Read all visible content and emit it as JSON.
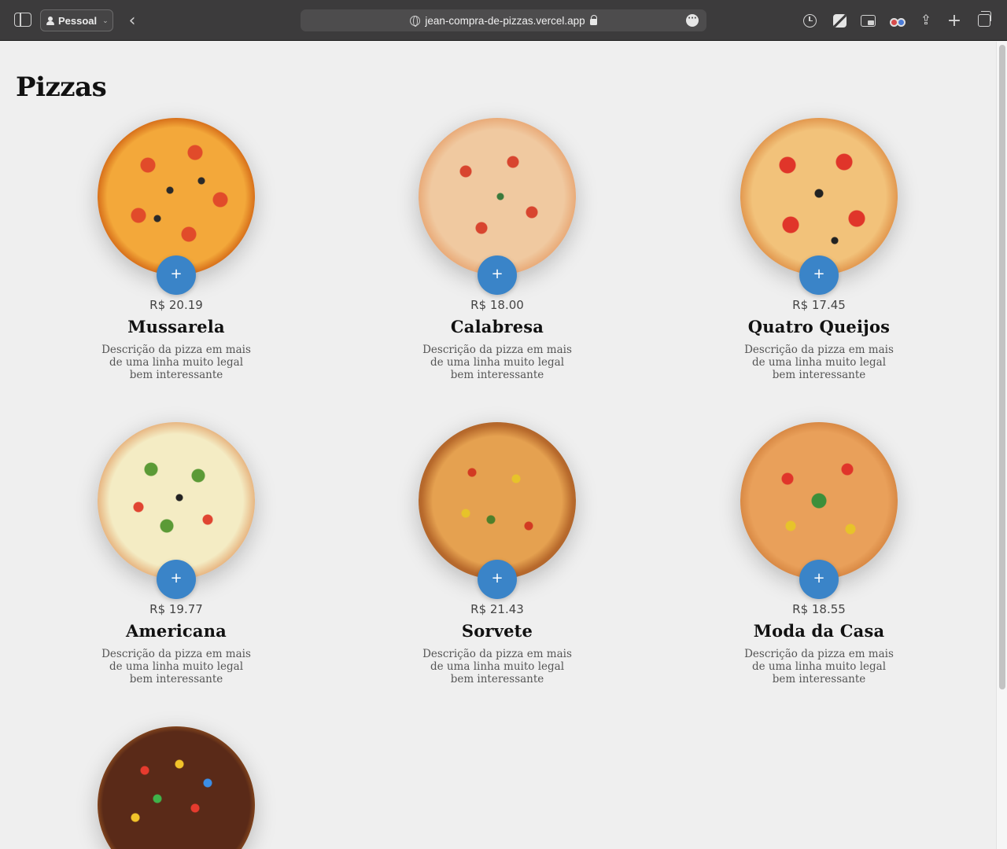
{
  "browser": {
    "profile_label": "Pessoal",
    "url": "jean-compra-de-pizzas.vercel.app",
    "icons": [
      "sidebar-icon",
      "person-icon",
      "chevron-down-icon",
      "back-icon",
      "globe-icon",
      "lock-icon",
      "more-icon",
      "history-icon",
      "extension-icon",
      "picture-in-picture-icon",
      "extension-glasses-icon",
      "share-icon",
      "new-tab-icon",
      "tab-overview-icon"
    ]
  },
  "page": {
    "title": "Pizzas",
    "add_button_label": "+",
    "accent_color": "#3a84c8",
    "pizzas": [
      {
        "name": "Mussarela",
        "price": "R$ 20.19",
        "description": "Descrição da pizza em mais de uma linha muito legal bem interessante"
      },
      {
        "name": "Calabresa",
        "price": "R$ 18.00",
        "description": "Descrição da pizza em mais de uma linha muito legal bem interessante"
      },
      {
        "name": "Quatro Queijos",
        "price": "R$ 17.45",
        "description": "Descrição da pizza em mais de uma linha muito legal bem interessante"
      },
      {
        "name": "Americana",
        "price": "R$ 19.77",
        "description": "Descrição da pizza em mais de uma linha muito legal bem interessante"
      },
      {
        "name": "Sorvete",
        "price": "R$ 21.43",
        "description": "Descrição da pizza em mais de uma linha muito legal bem interessante"
      },
      {
        "name": "Moda da Casa",
        "price": "R$ 18.55",
        "description": "Descrição da pizza em mais de uma linha muito legal bem interessante"
      },
      {
        "name": "",
        "price": "",
        "description": ""
      }
    ]
  }
}
